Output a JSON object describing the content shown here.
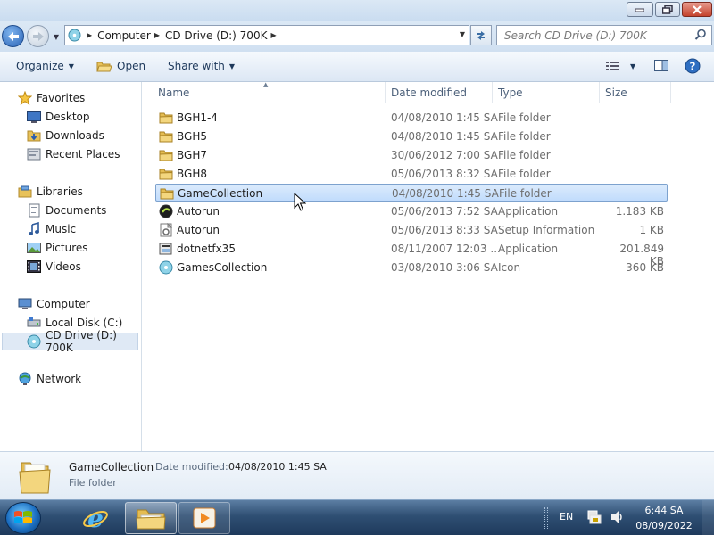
{
  "address": {
    "crumbs": [
      "Computer",
      "CD Drive (D:) 700K"
    ]
  },
  "search": {
    "placeholder": "Search CD Drive (D:) 700K"
  },
  "toolbar": {
    "organize": "Organize",
    "open": "Open",
    "share_with": "Share with"
  },
  "navpane": {
    "favorites": "Favorites",
    "desktop": "Desktop",
    "downloads": "Downloads",
    "recent_places": "Recent Places",
    "libraries": "Libraries",
    "documents": "Documents",
    "music": "Music",
    "pictures": "Pictures",
    "videos": "Videos",
    "computer": "Computer",
    "local_disk": "Local Disk (C:)",
    "cd_drive": "CD Drive (D:) 700K",
    "network": "Network"
  },
  "columns": {
    "name": "Name",
    "date_modified": "Date modified",
    "type": "Type",
    "size": "Size"
  },
  "files": [
    {
      "name": "BGH1-4",
      "date": "04/08/2010 1:45 SA",
      "type": "File folder",
      "size": "",
      "icon": "folder-icon"
    },
    {
      "name": "BGH5",
      "date": "04/08/2010 1:45 SA",
      "type": "File folder",
      "size": "",
      "icon": "folder-icon"
    },
    {
      "name": "BGH7",
      "date": "30/06/2012 7:00 SA",
      "type": "File folder",
      "size": "",
      "icon": "folder-icon"
    },
    {
      "name": "BGH8",
      "date": "05/06/2013 8:32 SA",
      "type": "File folder",
      "size": "",
      "icon": "folder-icon"
    },
    {
      "name": "GameCollection",
      "date": "04/08/2010 1:45 SA",
      "type": "File folder",
      "size": "",
      "icon": "folder-icon"
    },
    {
      "name": "Autorun",
      "date": "05/06/2013 7:52 SA",
      "type": "Application",
      "size": "1.183 KB",
      "icon": "application-icon"
    },
    {
      "name": "Autorun",
      "date": "05/06/2013 8:33 SA",
      "type": "Setup Information",
      "size": "1 KB",
      "icon": "setup-info-icon"
    },
    {
      "name": "dotnetfx35",
      "date": "08/11/2007 12:03 ...",
      "type": "Application",
      "size": "201.849 KB",
      "icon": "installer-icon"
    },
    {
      "name": "GamesCollection",
      "date": "03/08/2010 3:06 SA",
      "type": "Icon",
      "size": "360 KB",
      "icon": "icon-file-icon"
    }
  ],
  "details": {
    "name": "GameCollection",
    "date_label": "Date modified:",
    "date_value": "04/08/2010 1:45 SA",
    "type": "File folder"
  },
  "taskbar": {
    "language": "EN",
    "time": "6:44 SA",
    "date": "08/09/2022"
  },
  "colors": {
    "selection": "#c1dcfc",
    "titlebar": "#dbe8f5",
    "taskbar": "#2f4f73",
    "close": "#c4422c"
  }
}
